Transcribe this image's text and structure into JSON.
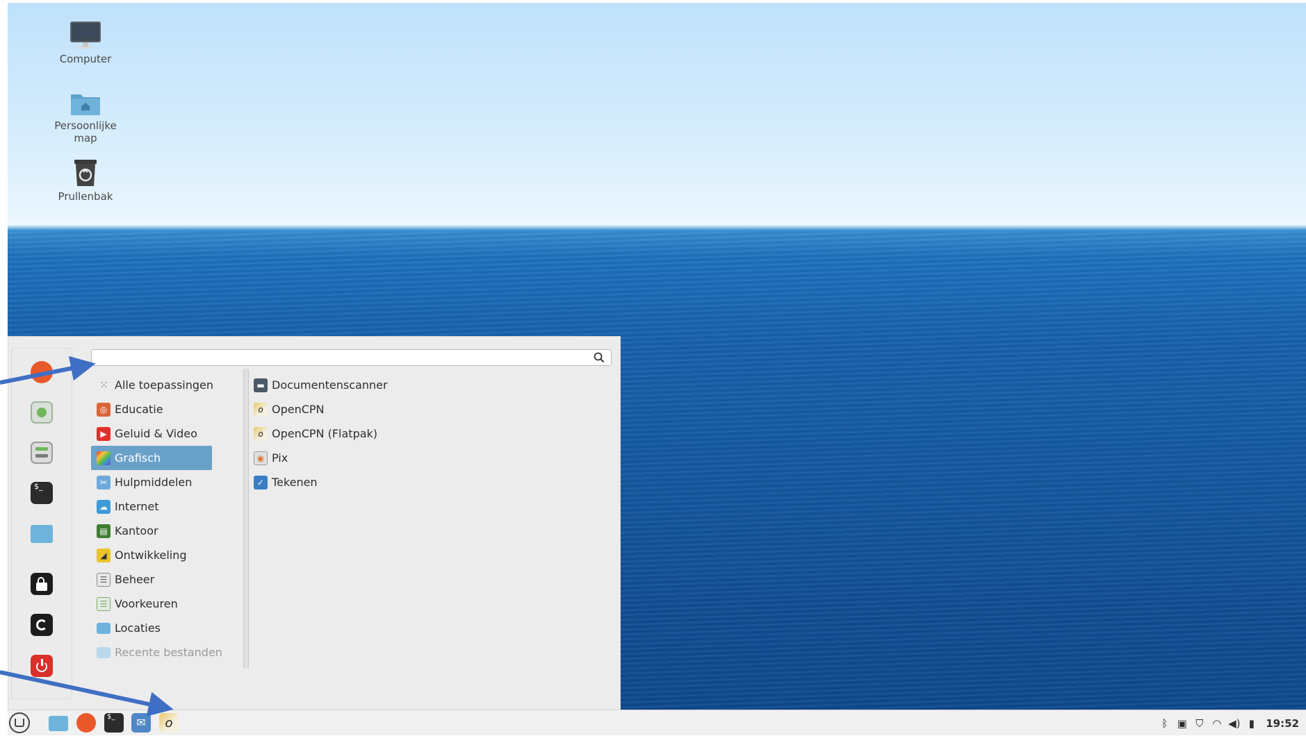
{
  "desktop": {
    "icons": [
      {
        "label": "Computer",
        "icon": "monitor-icon"
      },
      {
        "label": "Persoonlijke map",
        "icon": "home-folder-icon"
      },
      {
        "label": "Prullenbak",
        "icon": "trash-icon"
      }
    ]
  },
  "menu": {
    "search": {
      "value": "",
      "placeholder": ""
    },
    "favorites": [
      "firefox-icon",
      "software-manager-icon",
      "settings-icon",
      "terminal-icon",
      "folder-icon",
      "lock-icon",
      "logout-icon",
      "power-icon"
    ],
    "categories": [
      {
        "label": "Alle toepassingen",
        "icon": "grid-icon"
      },
      {
        "label": "Educatie",
        "icon": "education-icon"
      },
      {
        "label": "Geluid & Video",
        "icon": "media-icon"
      },
      {
        "label": "Grafisch",
        "icon": "graphics-icon",
        "selected": true
      },
      {
        "label": "Hulpmiddelen",
        "icon": "accessories-icon"
      },
      {
        "label": "Internet",
        "icon": "internet-icon"
      },
      {
        "label": "Kantoor",
        "icon": "office-icon"
      },
      {
        "label": "Ontwikkeling",
        "icon": "development-icon"
      },
      {
        "label": "Beheer",
        "icon": "admin-icon"
      },
      {
        "label": "Voorkeuren",
        "icon": "preferences-icon"
      },
      {
        "label": "Locaties",
        "icon": "places-icon"
      },
      {
        "label": "Recente bestanden",
        "icon": "recent-files-icon",
        "disabled": true
      }
    ],
    "apps": [
      {
        "label": "Documentenscanner",
        "icon": "scanner-icon"
      },
      {
        "label": "OpenCPN",
        "icon": "opencpn-icon"
      },
      {
        "label": "OpenCPN (Flatpak)",
        "icon": "opencpn-icon"
      },
      {
        "label": "Pix",
        "icon": "pix-icon"
      },
      {
        "label": "Tekenen",
        "icon": "drawing-icon"
      }
    ]
  },
  "taskbar": {
    "launchers": [
      "mint-menu-icon",
      "files-icon",
      "firefox-icon",
      "terminal-icon",
      "mail-icon",
      "opencpn-icon"
    ],
    "tray": [
      "bluetooth-icon",
      "clipboard-icon",
      "shield-icon",
      "wifi-icon",
      "volume-icon",
      "power-manager-icon"
    ],
    "clock": "19:52"
  },
  "colors": {
    "selection": "#6aa1c9",
    "annotation_arrow": "#3f6fc4",
    "sea": "#1862ad",
    "sky": "#d2ebfc"
  }
}
